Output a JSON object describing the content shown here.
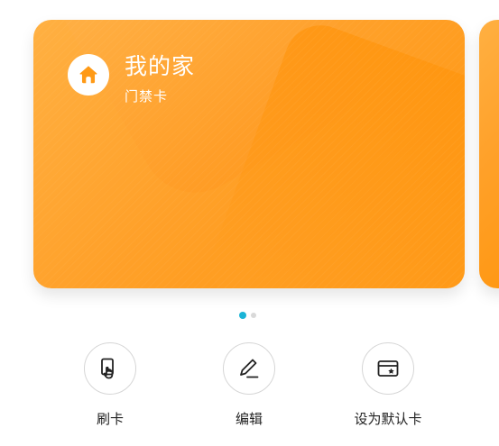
{
  "card": {
    "title": "我的家",
    "subtitle": "门禁卡",
    "icon": "home-icon",
    "color": "#ffa12a"
  },
  "pager": {
    "count": 2,
    "active_index": 0,
    "active_color": "#1bb4d6"
  },
  "actions": [
    {
      "label": "刷卡",
      "icon": "swipe-card-icon"
    },
    {
      "label": "编辑",
      "icon": "edit-pen-icon"
    },
    {
      "label": "设为默认卡",
      "icon": "default-card-icon"
    }
  ]
}
